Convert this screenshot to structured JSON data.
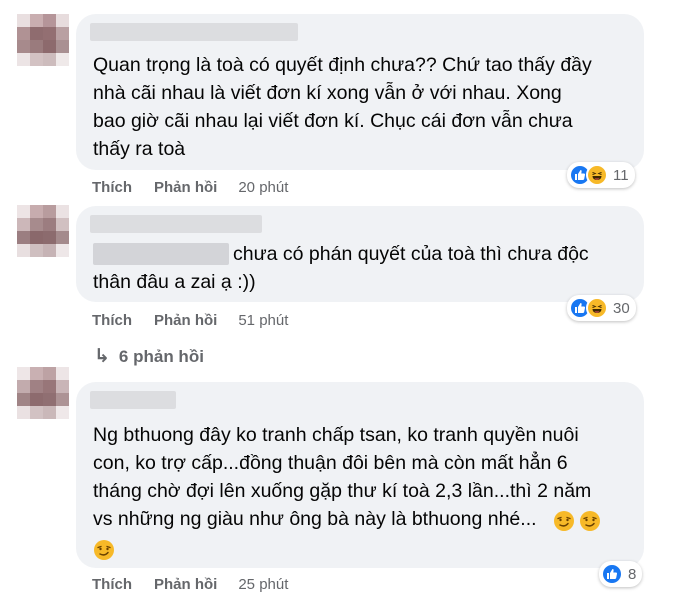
{
  "colors": {
    "bubble": "#f0f2f5",
    "meta_text": "#65676b",
    "like_blue": "#1877f2",
    "haha_yellow": "#f7b928"
  },
  "comments": [
    {
      "text_lines": [
        "Quan trọng là toà có quyết định chưa?? Chứ tao thấy đầy",
        "nhà cãi nhau là viết đơn kí xong vẫn ở với nhau. Xong",
        "bao giờ cãi nhau lại viết đơn kí. Chục cái đơn vẫn chưa",
        "thấy ra toà"
      ],
      "like_label": "Thích",
      "reply_label": "Phản hồi",
      "time": "20 phút",
      "reactions": [
        "like-icon",
        "haha-icon"
      ],
      "reaction_count": "11"
    },
    {
      "text_lines": [
        "chưa có phán quyết của toà thì chưa độc",
        "thân đâu a zai ạ :))"
      ],
      "like_label": "Thích",
      "reply_label": "Phản hồi",
      "time": "51 phút",
      "reactions": [
        "like-icon",
        "haha-icon"
      ],
      "reaction_count": "30"
    },
    {
      "text_lines": [
        "Ng bthuong đây ko tranh chấp tsan, ko tranh quyền nuôi",
        "con, ko trợ cấp...đồng thuận đôi bên mà còn mất hẳn 6",
        "tháng chờ đợi lên xuống gặp thư kí toà 2,3 lần...thì 2 năm",
        "vs những ng giàu như ông bà này là bthuong nhé..."
      ],
      "inline_emoji": [
        "smirk-emoji",
        "smirk-emoji",
        "smirk-emoji"
      ],
      "like_label": "Thích",
      "reply_label": "Phản hồi",
      "time": "25 phút",
      "reactions": [
        "like-icon"
      ],
      "reaction_count": "8"
    }
  ],
  "view_replies": {
    "arrow": "↳",
    "label": "6 phản hồi"
  }
}
